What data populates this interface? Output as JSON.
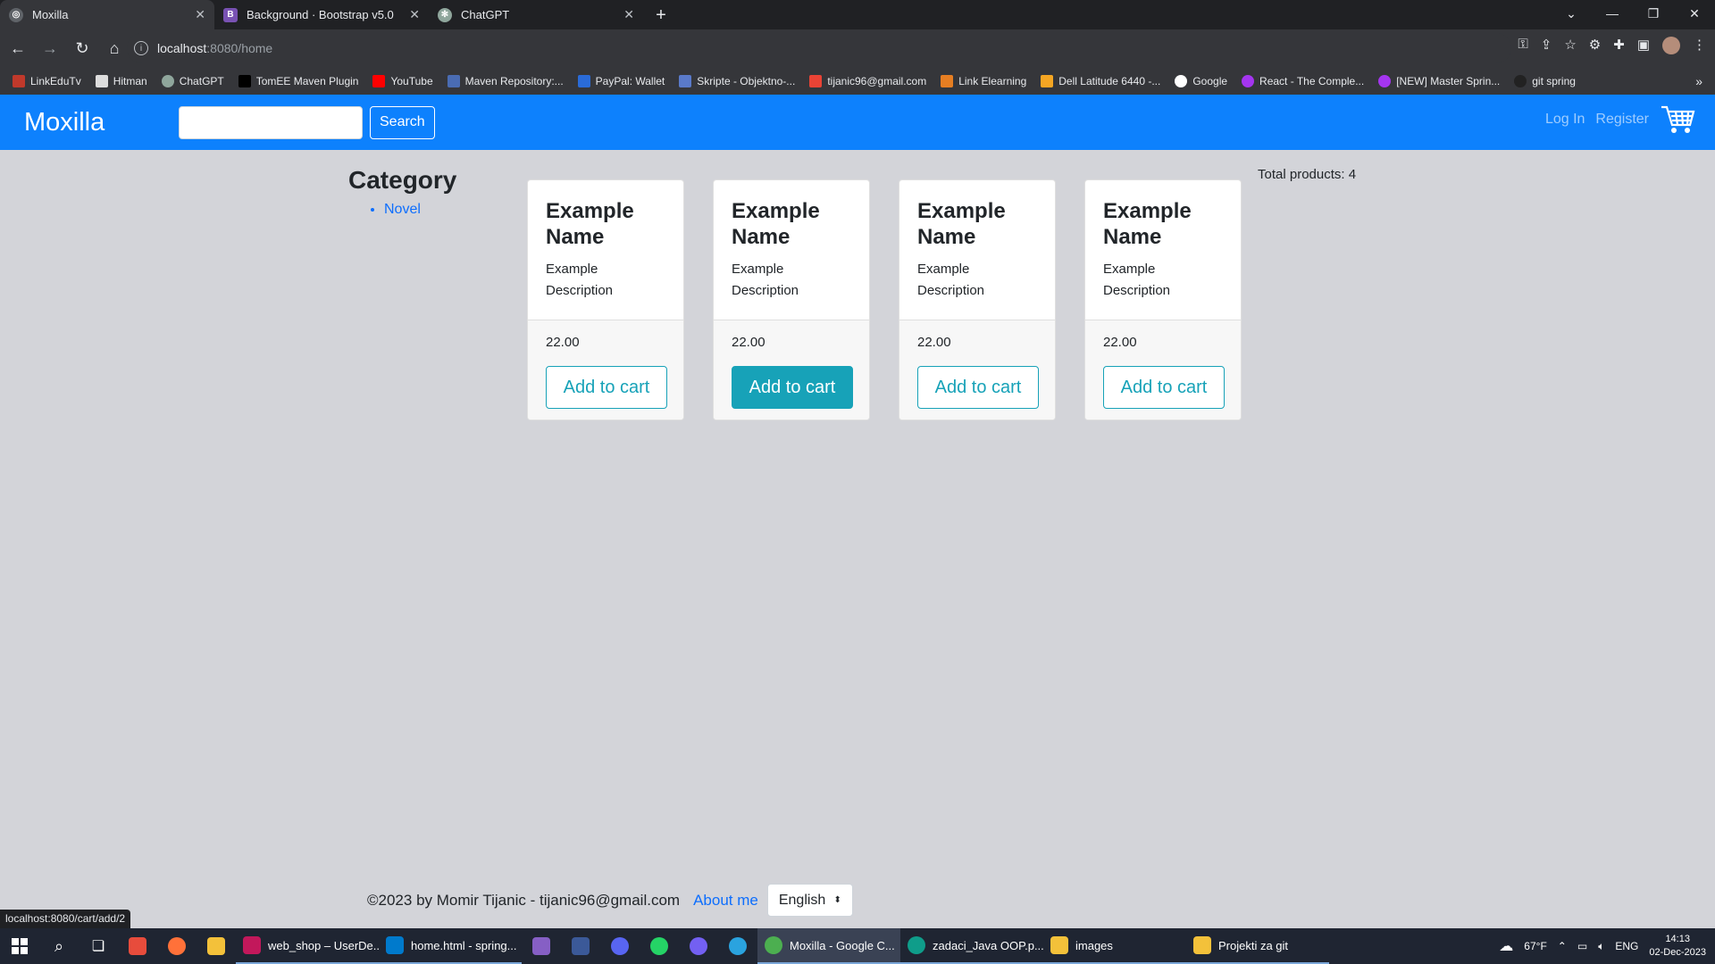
{
  "browser": {
    "tabs": [
      {
        "title": "Moxilla",
        "active": true,
        "icon": "globe-icon"
      },
      {
        "title": "Background · Bootstrap v5.0",
        "active": false,
        "icon": "bootstrap-icon"
      },
      {
        "title": "ChatGPT",
        "active": false,
        "icon": "chatgpt-icon"
      }
    ],
    "address": {
      "host": "localhost",
      "rest": ":8080/home"
    },
    "bookmarks": [
      "LinkEduTv",
      "Hitman",
      "ChatGPT",
      "TomEE Maven Plugin",
      "YouTube",
      "Maven Repository:...",
      "PayPal: Wallet",
      "Skripte - Objektno-...",
      "tijanic96@gmail.com",
      "Link Elearning",
      "Dell Latitude 6440 -...",
      "Google",
      "React - The Comple...",
      "[NEW] Master Sprin...",
      "git spring"
    ],
    "status_url": "localhost:8080/cart/add/2"
  },
  "navbar": {
    "brand": "Moxilla",
    "search_button": "Search",
    "search_placeholder": "",
    "login": "Log In",
    "register": "Register"
  },
  "sidebar": {
    "title": "Category",
    "categories": [
      "Novel"
    ]
  },
  "products": [
    {
      "name": "Example Name",
      "description": "Example Description",
      "price": "22.00",
      "button": "Add to cart"
    },
    {
      "name": "Example Name",
      "description": "Example Description",
      "price": "22.00",
      "button": "Add to cart"
    },
    {
      "name": "Example Name",
      "description": "Example Description",
      "price": "22.00",
      "button": "Add to cart"
    },
    {
      "name": "Example Name",
      "description": "Example Description",
      "price": "22.00",
      "button": "Add to cart"
    }
  ],
  "total_products": "Total products: 4",
  "footer": {
    "copyright": "©2023 by Momir Tijanic - tijanic96@gmail.com",
    "about": "About me",
    "language": "English"
  },
  "taskbar": {
    "apps": [
      "web_shop – UserDe...",
      "home.html - spring...",
      "Moxilla - Google C...",
      "zadaci_Java OOP.p...",
      "images",
      "Projekti za git"
    ],
    "weather": "67°F",
    "lang": "ENG",
    "time": "14:13",
    "date": "02-Dec-2023"
  },
  "colors": {
    "brand_blue": "#0d81fd",
    "button_teal": "#17a2b8",
    "page_bg": "#d3d4d9"
  }
}
